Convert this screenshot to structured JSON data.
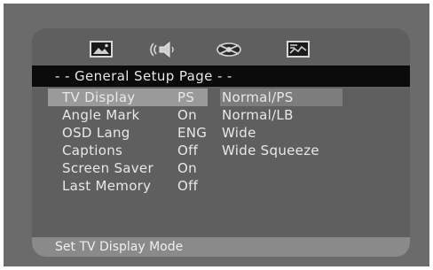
{
  "icons": [
    "general-setup-icon",
    "audio-setup-icon",
    "video-setup-icon",
    "preference-setup-icon"
  ],
  "page_title": "- - General Setup Page - -",
  "menu_items": [
    {
      "label": "TV Display",
      "value": "PS"
    },
    {
      "label": "Angle Mark",
      "value": "On"
    },
    {
      "label": "OSD Lang",
      "value": "ENG"
    },
    {
      "label": "Captions",
      "value": "Off"
    },
    {
      "label": "Screen Saver",
      "value": "On"
    },
    {
      "label": "Last Memory",
      "value": "Off"
    }
  ],
  "options": [
    "Normal/PS",
    "Normal/LB",
    "Wide",
    "Wide Squeeze"
  ],
  "status_text": "Set TV Display Mode",
  "colors": {
    "background": "#6b6b6b",
    "screen": "#5f5f5f",
    "title_bar": "#0b0b0b",
    "selected_row": "#9a9a9a",
    "status_bar": "#8a8a8a"
  }
}
